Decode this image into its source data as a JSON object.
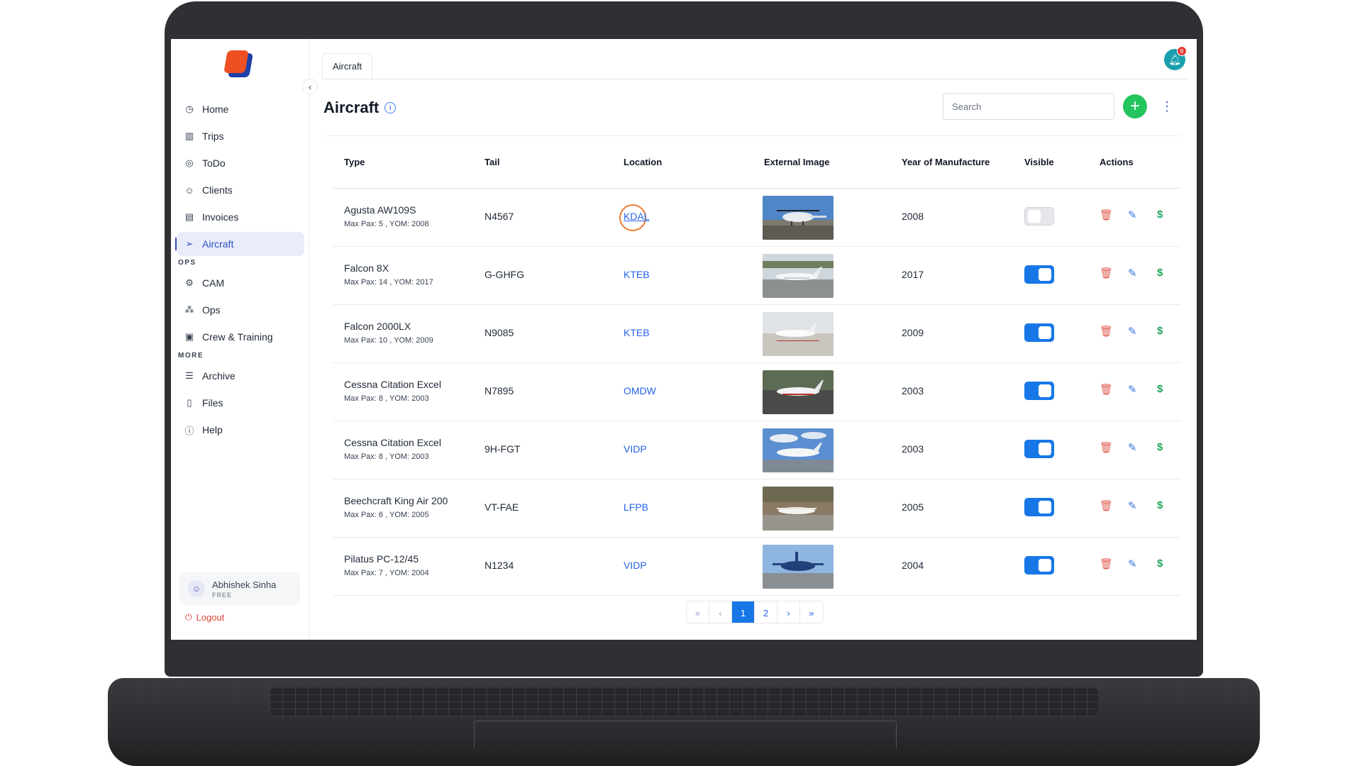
{
  "sidebar": {
    "items": [
      {
        "label": "Home",
        "icon": "compass-icon"
      },
      {
        "label": "Trips",
        "icon": "map-icon"
      },
      {
        "label": "ToDo",
        "icon": "target-icon"
      },
      {
        "label": "Clients",
        "icon": "users-icon"
      },
      {
        "label": "Invoices",
        "icon": "invoice-icon"
      },
      {
        "label": "Aircraft",
        "icon": "send-icon",
        "active": true
      }
    ],
    "sections": [
      {
        "title": "OPS",
        "items": [
          {
            "label": "CAM",
            "icon": "gear-icon"
          },
          {
            "label": "Ops",
            "icon": "org-chart-icon"
          },
          {
            "label": "Crew & Training",
            "icon": "briefcase-icon"
          }
        ]
      },
      {
        "title": "MORE",
        "items": [
          {
            "label": "Archive",
            "icon": "database-icon"
          },
          {
            "label": "Files",
            "icon": "file-icon"
          },
          {
            "label": "Help",
            "icon": "help-icon"
          }
        ]
      }
    ],
    "user": {
      "name": "Abhishek Sinha",
      "plan": "FREE"
    },
    "logout_label": "Logout"
  },
  "header": {
    "tab_label": "Aircraft",
    "title": "Aircraft",
    "search_placeholder": "Search",
    "notification_count": "8"
  },
  "table": {
    "columns": [
      "Type",
      "Tail",
      "Location",
      "External Image",
      "Year of Manufacture",
      "Visible",
      "Actions"
    ],
    "rows": [
      {
        "type": "Agusta AW109S",
        "sub": "Max Pax: 5 , YOM: 2008",
        "tail": "N4567",
        "location": "KDAL",
        "year": "2008",
        "visible": false
      },
      {
        "type": "Falcon 8X",
        "sub": "Max Pax: 14 , YOM: 2017",
        "tail": "G-GHFG",
        "location": "KTEB",
        "year": "2017",
        "visible": true
      },
      {
        "type": "Falcon 2000LX",
        "sub": "Max Pax: 10 , YOM: 2009",
        "tail": "N9085",
        "location": "KTEB",
        "year": "2009",
        "visible": true
      },
      {
        "type": "Cessna Citation Excel",
        "sub": "Max Pax: 8 , YOM: 2003",
        "tail": "N7895",
        "location": "OMDW",
        "year": "2003",
        "visible": true
      },
      {
        "type": "Cessna Citation Excel",
        "sub": "Max Pax: 8 , YOM: 2003",
        "tail": "9H-FGT",
        "location": "VIDP",
        "year": "2003",
        "visible": true
      },
      {
        "type": "Beechcraft King Air 200",
        "sub": "Max Pax: 6 , YOM: 2005",
        "tail": "VT-FAE",
        "location": "LFPB",
        "year": "2005",
        "visible": true
      },
      {
        "type": "Pilatus PC-12/45",
        "sub": "Max Pax: 7 , YOM: 2004",
        "tail": "N1234",
        "location": "VIDP",
        "year": "2004",
        "visible": true
      }
    ]
  },
  "pagination": {
    "first": "«",
    "prev": "‹",
    "pages": [
      "1",
      "2"
    ],
    "current": "1",
    "next": "›",
    "last": "»"
  },
  "colors": {
    "accent": "#1877e6",
    "active_nav": "#2f4fb9",
    "add_button": "#22c55e",
    "delete": "#e05a4f",
    "price": "#22a55a",
    "logout": "#e0453a"
  }
}
